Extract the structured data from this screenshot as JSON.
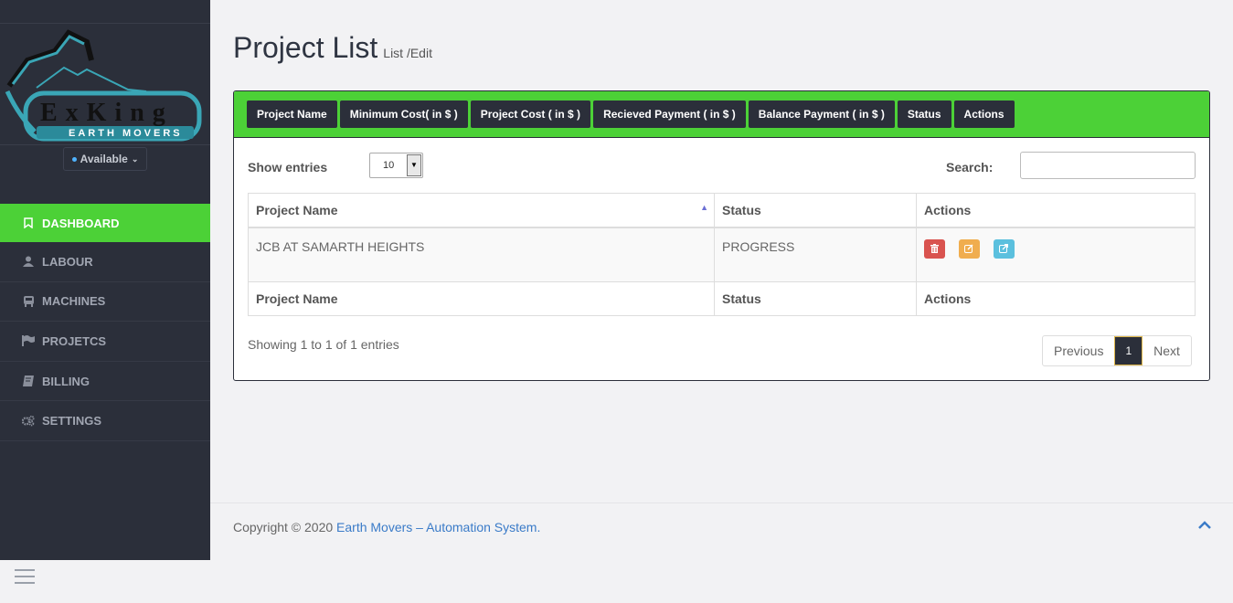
{
  "sidebar": {
    "logo": {
      "line1": "ExKing",
      "line2": "EARTH MOVERS"
    },
    "status": "Available",
    "items": [
      {
        "label": "DASHBOARD",
        "icon": "bookmark-icon",
        "active": true
      },
      {
        "label": "LABOUR",
        "icon": "user-icon",
        "active": false
      },
      {
        "label": "MACHINES",
        "icon": "bus-icon",
        "active": false
      },
      {
        "label": "PROJETCS",
        "icon": "flag-icon",
        "active": false
      },
      {
        "label": "BILLING",
        "icon": "book-icon",
        "active": false
      },
      {
        "label": "SETTINGS",
        "icon": "gears-icon",
        "active": false
      }
    ]
  },
  "header": {
    "title": "Project List",
    "subtitle": "List /Edit"
  },
  "columns_bar": [
    "Project Name",
    "Minimum Cost( in $ )",
    "Project Cost ( in $ )",
    "Recieved Payment ( in $ )",
    "Balance Payment ( in $ )",
    "Status",
    "Actions"
  ],
  "table_controls": {
    "show_entries_label": "Show entries",
    "entries_value": "10",
    "search_label": "Search:"
  },
  "table": {
    "headers": [
      "Project Name",
      "Status",
      "Actions"
    ],
    "rows": [
      {
        "project_name": "JCB AT SAMARTH HEIGHTS",
        "status": "PROGRESS"
      }
    ],
    "footers": [
      "Project Name",
      "Status",
      "Actions"
    ]
  },
  "info": "Showing 1 to 1 of 1 entries",
  "pagination": {
    "previous": "Previous",
    "current": "1",
    "next": "Next"
  },
  "footer": {
    "copyright": "Copyright © 2020 ",
    "link": "Earth Movers – Automation System",
    "tail": "."
  },
  "colors": {
    "accent": "#4cd137",
    "sidebar": "#2b2f3a"
  }
}
